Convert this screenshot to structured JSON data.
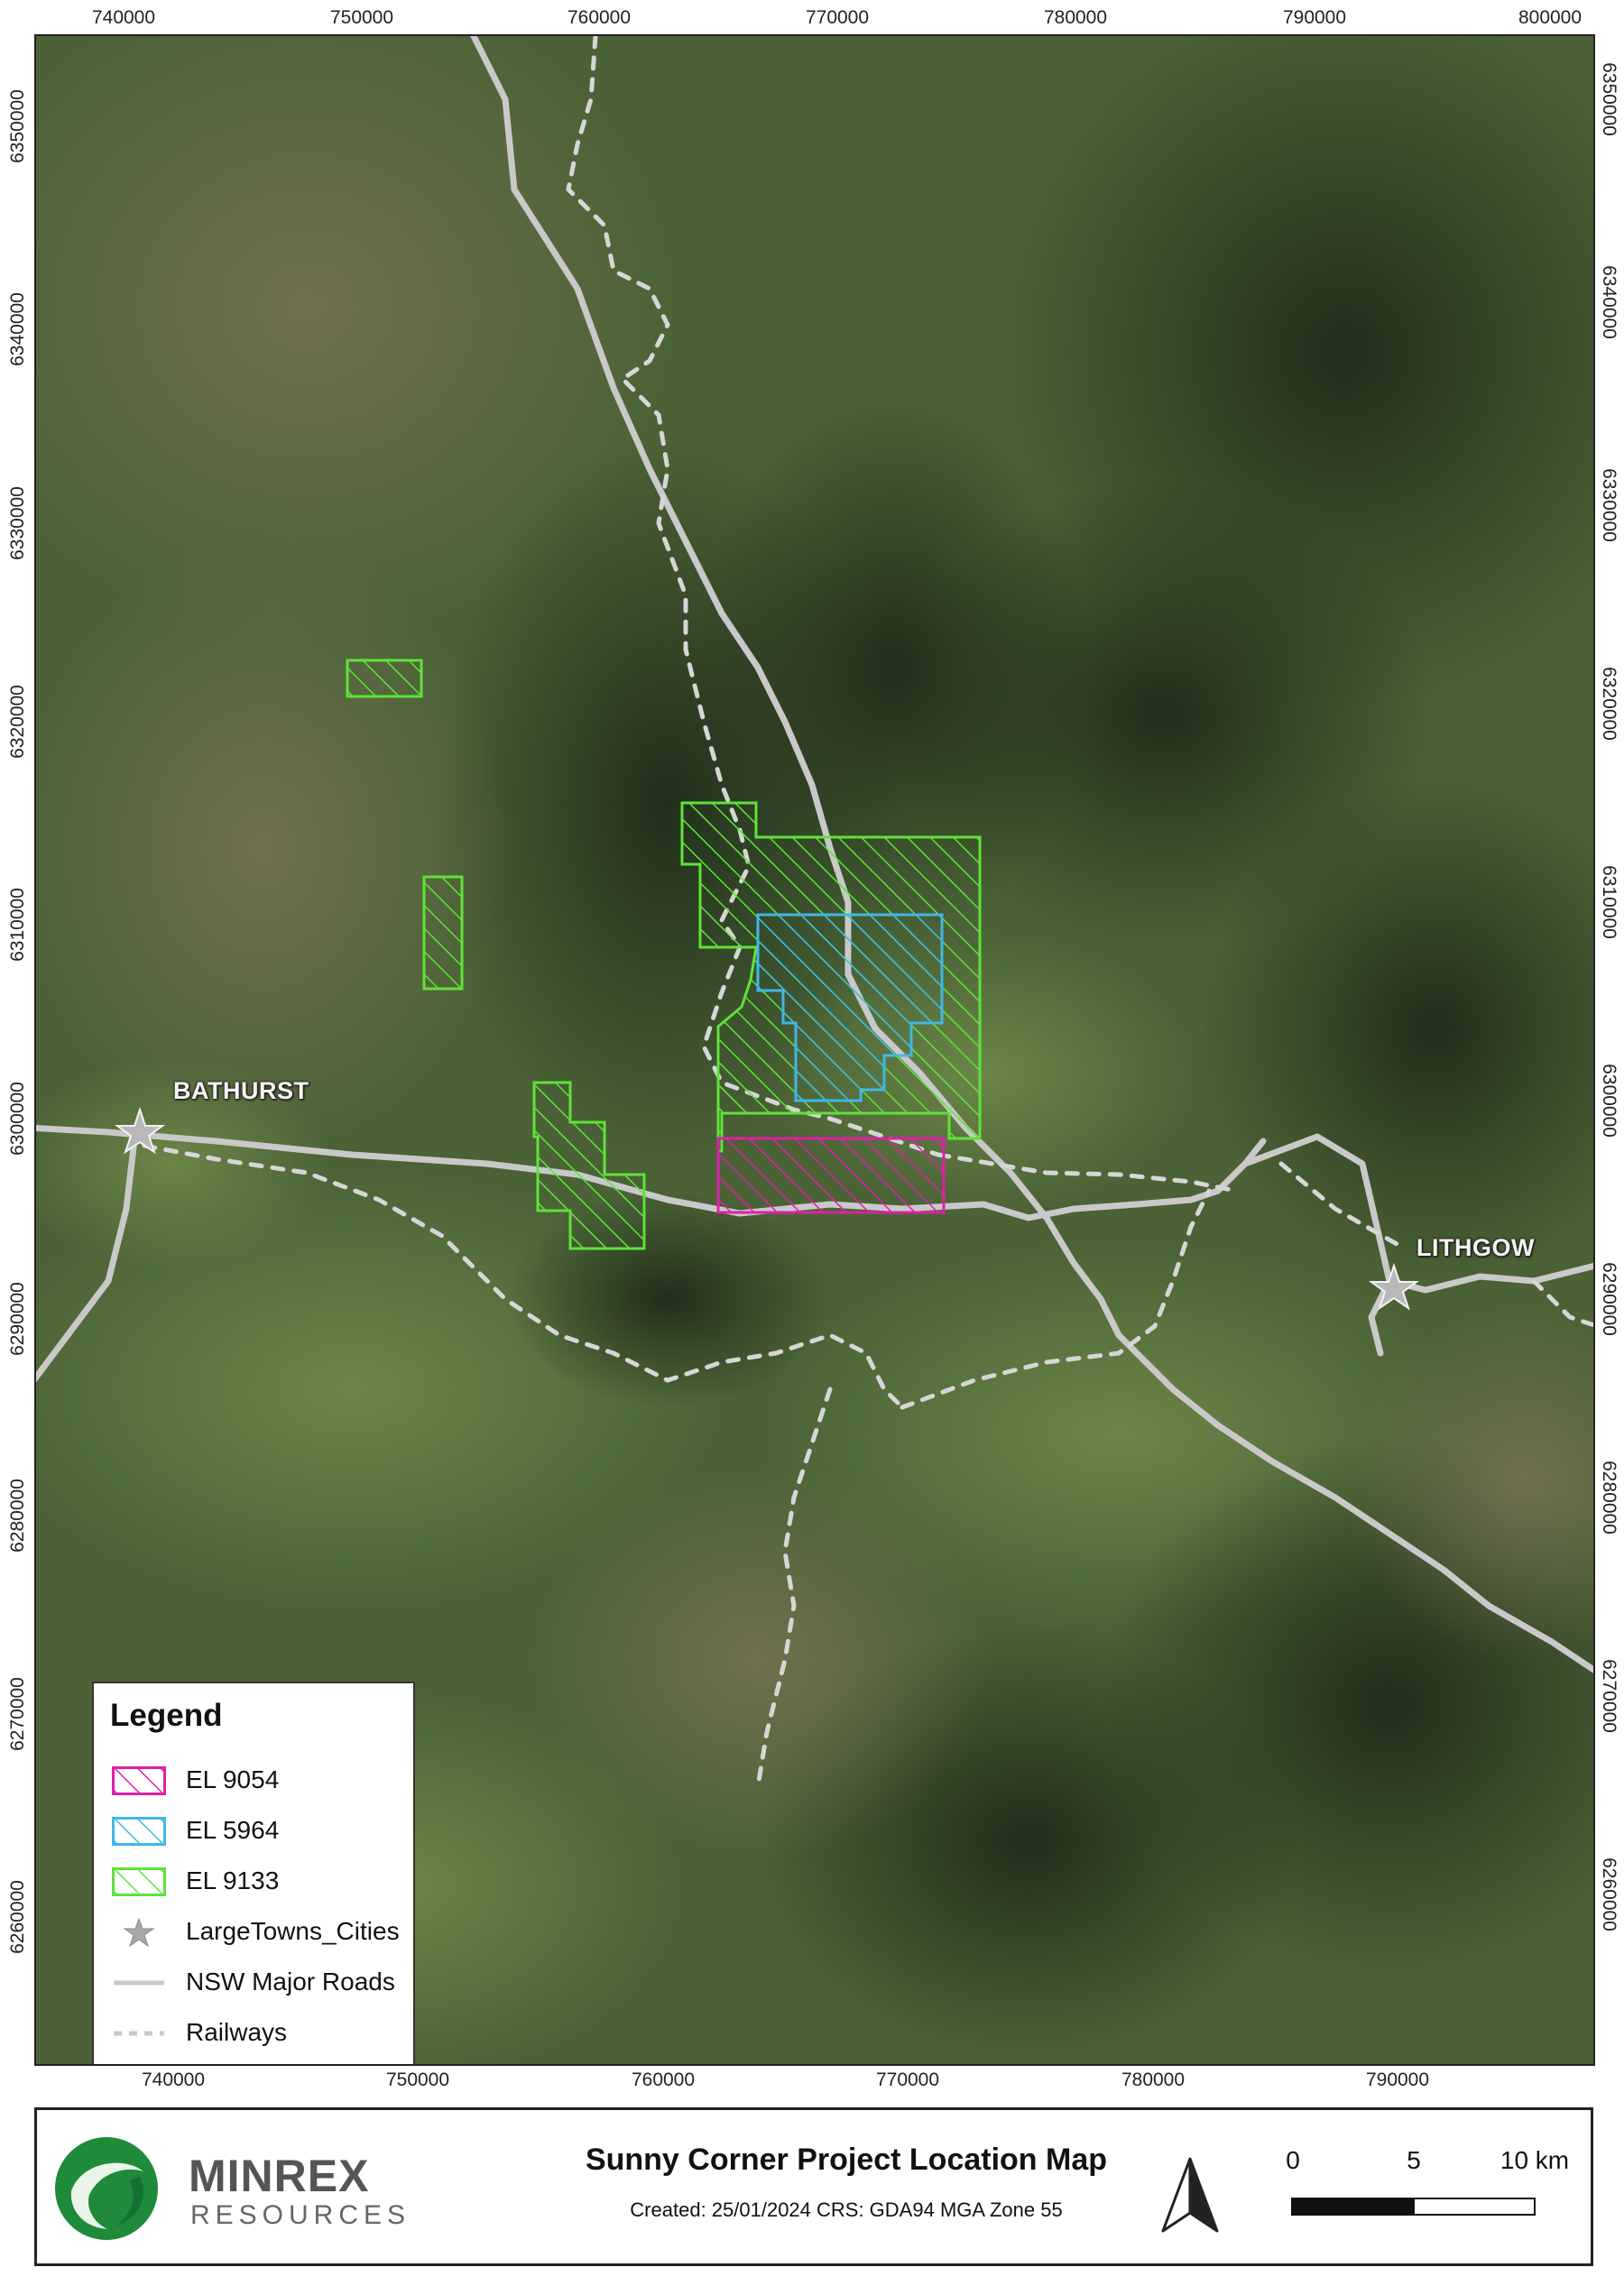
{
  "map": {
    "x_ticks": [
      "740000",
      "750000",
      "760000",
      "770000",
      "780000",
      "790000",
      "800000"
    ],
    "x_ticks_top": [
      "740000",
      "750000",
      "760000",
      "770000",
      "780000",
      "790000",
      "800000"
    ],
    "y_ticks": [
      "6350000",
      "6340000",
      "6330000",
      "6320000",
      "6310000",
      "6300000",
      "6290000",
      "6280000",
      "6270000",
      "6260000"
    ],
    "towns": [
      {
        "label": "BATHURST"
      },
      {
        "label": "LITHGOW"
      }
    ],
    "colors": {
      "el9054": "#e01fa8",
      "el5964": "#3fb8e6",
      "el9133": "#5fe23a",
      "roads": "#c9c9c9",
      "railways": "#d6d6d6"
    }
  },
  "legend": {
    "title": "Legend",
    "items": [
      {
        "label": "EL 9054",
        "symbol": "hatch",
        "color": "#e01fa8"
      },
      {
        "label": "EL 5964",
        "symbol": "hatch",
        "color": "#3fb8e6"
      },
      {
        "label": "EL 9133",
        "symbol": "hatch",
        "color": "#5fe23a"
      },
      {
        "label": "LargeTowns_Cities",
        "symbol": "star-icon",
        "color": "#a8a8a8"
      },
      {
        "label": "NSW Major Roads",
        "symbol": "solid-line",
        "color": "#c9c9c9"
      },
      {
        "label": "Railways",
        "symbol": "dashed-line",
        "color": "#c9c9c9"
      }
    ]
  },
  "footer": {
    "logo_name": "MINREX",
    "logo_sub": "RESOURCES",
    "title": "Sunny Corner Project Location Map",
    "meta": "Created: 25/01/2024 CRS: GDA94 MGA Zone 55",
    "north_icon": "north-arrow-icon",
    "scale_labels": [
      "0",
      "5",
      "10 km"
    ]
  }
}
